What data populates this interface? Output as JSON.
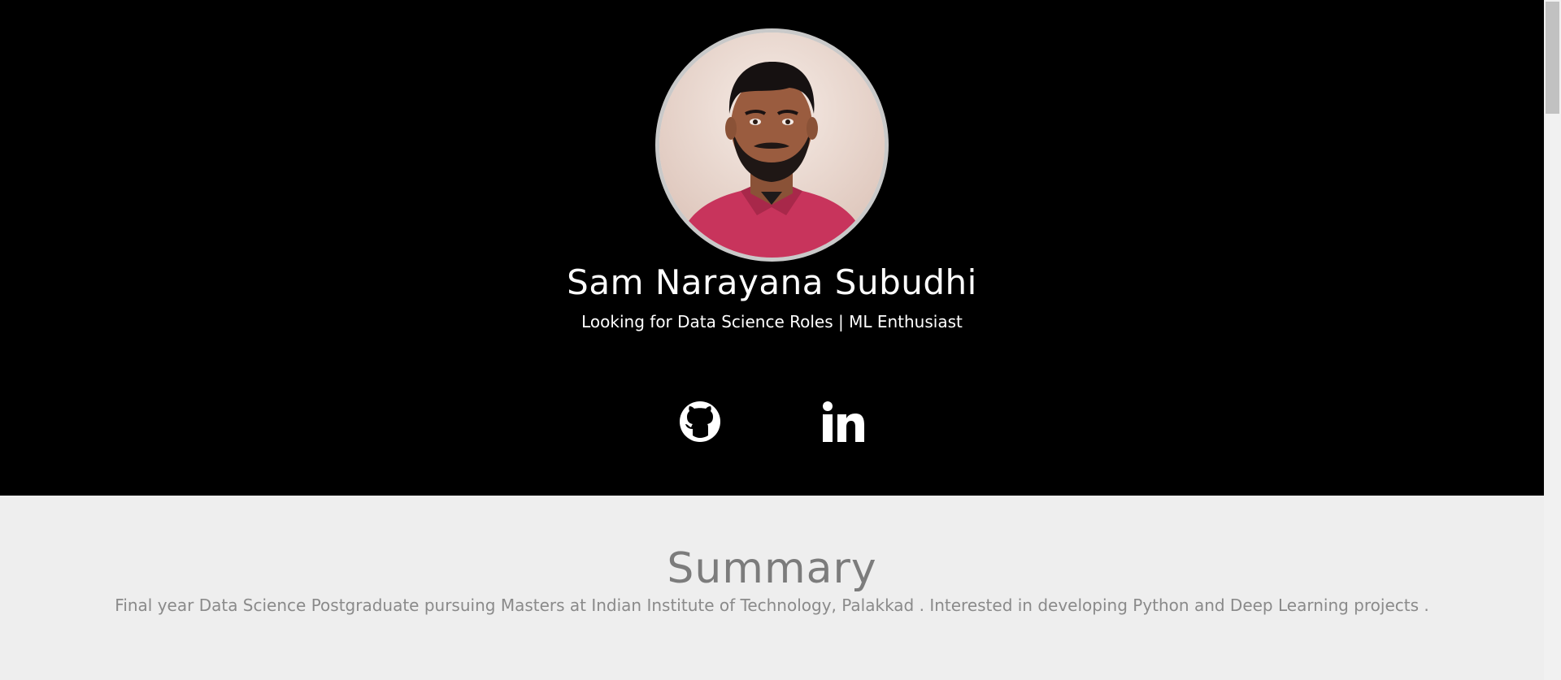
{
  "profile": {
    "name": "Sam Narayana Subudhi",
    "tagline": "Looking for Data Science Roles | ML Enthusiast"
  },
  "social": {
    "github_icon": "github-icon",
    "linkedin_icon": "linkedin-icon"
  },
  "summary": {
    "title": "Summary",
    "text": "Final year Data Science Postgraduate pursuing Masters at Indian Institute of Technology, Palakkad . Interested in developing Python and Deep Learning projects ."
  },
  "colors": {
    "hero_bg": "#000000",
    "summary_bg": "#eeeeee",
    "avatar_border": "#c9c9c9",
    "shirt": "#c8345c"
  }
}
